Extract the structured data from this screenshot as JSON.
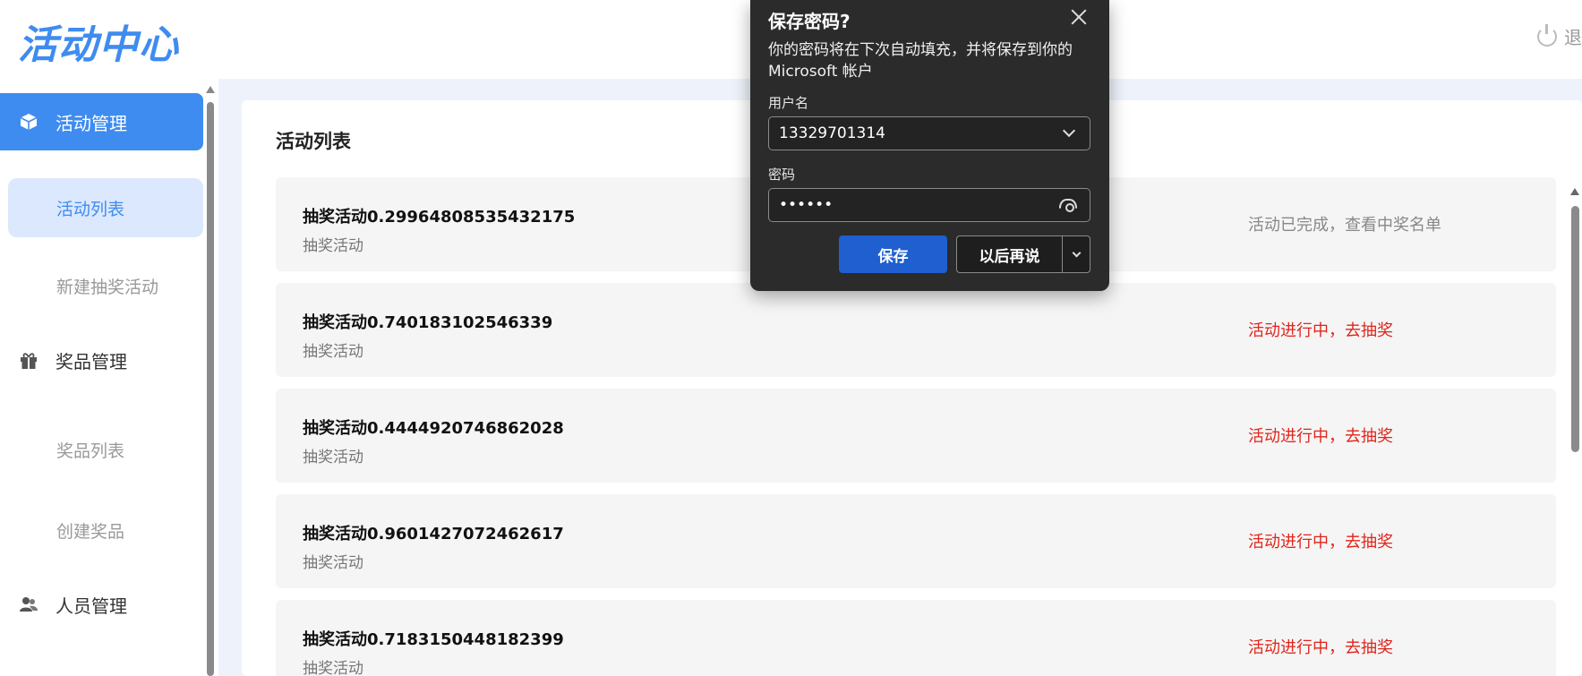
{
  "header": {
    "logo": "活动中心",
    "logout_label": "退"
  },
  "sidebar": {
    "groups": [
      {
        "label": "活动管理",
        "icon": "cube-icon",
        "items": [
          "活动列表",
          "新建抽奖活动"
        ]
      },
      {
        "label": "奖品管理",
        "icon": "gift-icon",
        "items": [
          "奖品列表",
          "创建奖品"
        ]
      },
      {
        "label": "人员管理",
        "icon": "users-icon",
        "items": []
      }
    ]
  },
  "main": {
    "title": "活动列表",
    "items": [
      {
        "name": "抽奖活动0.29964808535432175",
        "type": "抽奖活动",
        "status": "活动已完成，查看中奖名单"
      },
      {
        "name": "抽奖活动0.740183102546339",
        "type": "抽奖活动",
        "status": "活动进行中，去抽奖"
      },
      {
        "name": "抽奖活动0.4444920746862028",
        "type": "抽奖活动",
        "status": "活动进行中，去抽奖"
      },
      {
        "name": "抽奖活动0.9601427072462617",
        "type": "抽奖活动",
        "status": "活动进行中，去抽奖"
      },
      {
        "name": "抽奖活动0.7183150448182399",
        "type": "抽奖活动",
        "status": "活动进行中，去抽奖"
      }
    ]
  },
  "password_dialog": {
    "title": "保存密码?",
    "description": "你的密码将在下次自动填充，并将保存到你的 Microsoft 帐户",
    "username_label": "用户名",
    "username_value": "13329701314",
    "password_label": "密码",
    "password_value": "••••••",
    "save_label": "保存",
    "later_label": "以后再说"
  },
  "colors": {
    "accent": "#3f8cf0",
    "status_active": "#e1251b",
    "status_done": "#888888",
    "dialog_bg": "#2b2b2b",
    "dialog_save": "#1f5fcf"
  }
}
